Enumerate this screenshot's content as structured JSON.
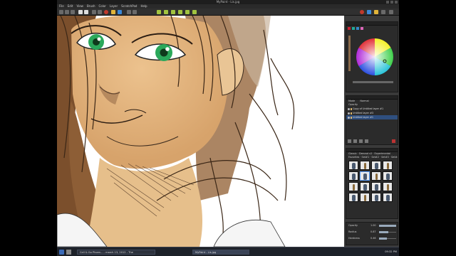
{
  "window": {
    "title": "MyPaint - Lis.jpg"
  },
  "menu": [
    "File",
    "Edit",
    "View",
    "Brush",
    "Color",
    "Layer",
    "ScratchPad",
    "Help"
  ],
  "color_panel": {
    "selected_color": "#2b2a28"
  },
  "layers": {
    "mode_label": "Mode",
    "mode_value": "Normal",
    "opacity_label": "Opacity",
    "items": [
      {
        "name": "Copy of Untitled layer #1"
      },
      {
        "name": "Untitled layer #3"
      },
      {
        "name": "Untitled layer #1"
      }
    ]
  },
  "brushes": {
    "tabs": "Classic · Deevad v2 · Experimental",
    "tabs2": "Favorites · Set#1 · Set#2 · Set#3 · Set#4"
  },
  "settings": [
    {
      "label": "Opacity",
      "value": "1.00",
      "level": 1.0
    },
    {
      "label": "Radius",
      "value": "0.87",
      "level": 0.55
    },
    {
      "label": "Hardness",
      "value": "0.46",
      "level": 0.46
    }
  ],
  "taskbar": {
    "tasks": [
      "Cell & Go Phoen... - march 13, 2012 - The",
      "MyPaint - Lis.jpg"
    ],
    "clock": "09:32 PM"
  }
}
